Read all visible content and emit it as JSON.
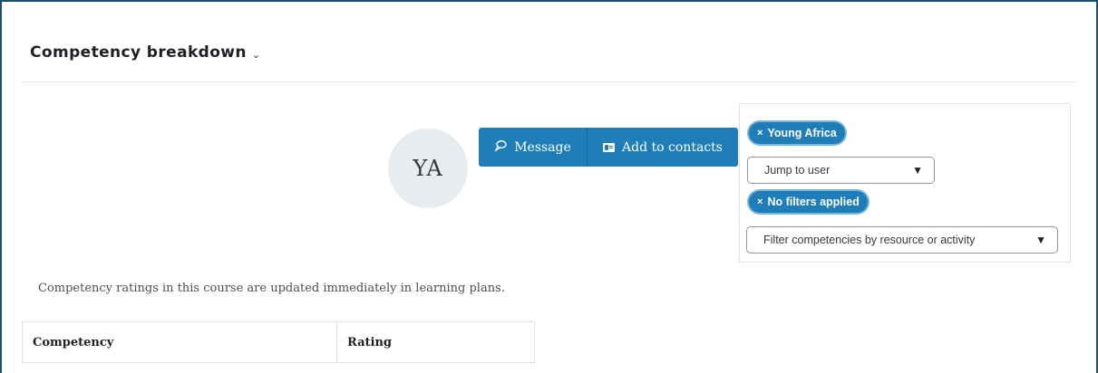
{
  "header": {
    "title": "Competency breakdown",
    "title_chevron": "⌄"
  },
  "user": {
    "initials": "YA",
    "message_label": "Message",
    "add_contacts_label": "Add to contacts"
  },
  "filters": {
    "user_badge": "Young Africa",
    "user_badge_x": "×",
    "jump_placeholder": "Jump to user",
    "filter_badge": "No filters applied",
    "filter_badge_x": "×",
    "filter_select": "Filter competencies by resource or activity",
    "arrow": "▼"
  },
  "notice": "Competency ratings in this course are updated immediately in learning plans.",
  "table": {
    "columns": [
      "Competency",
      "Rating"
    ]
  },
  "colors": {
    "accent": "#1f7db8",
    "frame": "#1f4f6e"
  },
  "icons": {
    "message": "speech-bubble-icon",
    "contacts": "address-card-icon"
  }
}
